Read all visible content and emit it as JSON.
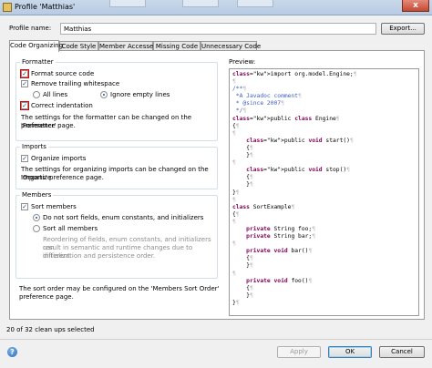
{
  "window": {
    "title": "Profile 'Matthias'",
    "close_glyph": "x"
  },
  "profile": {
    "label": "Profile name:",
    "value": "Matthias",
    "export_label": "Export..."
  },
  "tabs": [
    {
      "label": "Code Organizing",
      "active": true
    },
    {
      "label": "Code Style",
      "active": false
    },
    {
      "label": "Member Accesses",
      "active": false
    },
    {
      "label": "Missing Code",
      "active": false
    },
    {
      "label": "Unnecessary Code",
      "active": false
    }
  ],
  "formatter": {
    "title": "Formatter",
    "format_source": {
      "label": "Format source code",
      "checked": true
    },
    "remove_trailing": {
      "label": "Remove trailing whitespace",
      "checked": true
    },
    "all_lines": {
      "label": "All lines",
      "selected": false
    },
    "ignore_empty": {
      "label": "Ignore empty lines",
      "selected": true
    },
    "correct_indentation": {
      "label": "Correct indentation",
      "checked": true
    },
    "note_1": "The settings for the formatter can be changed on the 'Formatter'",
    "note_2": "preference page."
  },
  "imports": {
    "title": "Imports",
    "organize": {
      "label": "Organize imports",
      "checked": true
    },
    "note_1": "The settings for organizing imports can be changed on the 'Organize",
    "note_2": "Imports' preference page."
  },
  "members": {
    "title": "Members",
    "sort_members": {
      "label": "Sort members",
      "checked": true
    },
    "do_not_sort": {
      "label": "Do not sort fields, enum constants, and initializers",
      "selected": true
    },
    "sort_all": {
      "label": "Sort all members",
      "selected": false
    },
    "warn_1": "Reordering of fields, enum constants, and initializers can",
    "warn_2": "result in semantic and runtime changes due to different",
    "warn_3": "initialization and persistence order.",
    "note_1": "The sort order may be configured on the 'Members Sort Order'",
    "note_2": "preference page."
  },
  "preview": {
    "label": "Preview:",
    "lines": [
      "import org.model.Engine;¶",
      "¶",
      "/**¶",
      " *A Javadoc comment¶",
      " * @since 2007¶",
      " */¶",
      "public class Engine¶",
      "{¶",
      "¶",
      "    public void start()¶",
      "    {¶",
      "    }¶",
      "¶",
      "    public void stop()¶",
      "    {¶",
      "    }¶",
      "}¶",
      "¶",
      "class SortExample¶",
      "{¶",
      "¶",
      "    private String foo;¶",
      "    private String bar;¶",
      "¶",
      "    private void bar()¶",
      "    {¶",
      "    }¶",
      "¶",
      "    private void foo()¶",
      "    {¶",
      "    }¶",
      "}¶"
    ]
  },
  "status": "20 of 32 clean ups selected",
  "buttons": {
    "apply": "Apply",
    "ok": "OK",
    "cancel": "Cancel"
  },
  "icons": {
    "check": "✓",
    "help": "?"
  },
  "colors": {
    "keyword": "#7f0055",
    "comment": "#3f5fbf",
    "highlight": "#e00000"
  }
}
